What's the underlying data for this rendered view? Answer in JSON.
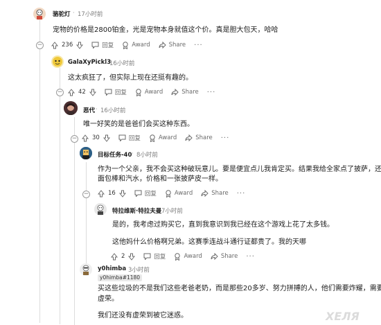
{
  "comments": [
    {
      "username": "骆驼灯",
      "time": "17小时前",
      "text": "宠物的价格是2800铂金，光是宠物本身就值这个价。真是胆大包天，哈哈",
      "votes": "236",
      "reply": "回复",
      "award": "Award",
      "share": "Share",
      "more": "···"
    },
    {
      "username": "GalaXyPickl3",
      "time": "16小时前",
      "text": "这太疯狂了，但实际上现在还挺有趣的。",
      "votes": "42",
      "reply": "回复",
      "award": "Award",
      "share": "Share",
      "more": "···"
    },
    {
      "username": "恶代",
      "time": "16小时前",
      "text": "唯一好笑的是爸爸们会买这种东西。",
      "votes": "30",
      "reply": "回复",
      "award": "Award",
      "share": "Share",
      "more": "···"
    },
    {
      "username": "目标任务-40",
      "time": "8小时前",
      "text_line1": "作为一个父亲，我不会买这种破玩意儿。要是便宜点儿我肯定买。结果我给全家点了披萨，还有",
      "text_line2": "面包棒和汽水，价格和一张披萨皮一样。",
      "votes": "16",
      "reply": "回复",
      "award": "Award",
      "share": "Share",
      "more": "···"
    },
    {
      "username": "特拉维斯·特拉夫曼",
      "time": "7小时前",
      "text_line1": "是的，我考虑过购买它，直到我意识到我已经在这个游戏上花了太多钱。",
      "text_line2": "这他妈什么价格啊兄弟。这赛季连战斗通行证都贵了。我的天哪",
      "votes": "2",
      "reply": "回复",
      "award": "Award",
      "share": "Share",
      "more": "···"
    },
    {
      "username": "y0himba",
      "time": "3小时前",
      "flair": "y0himba#1180",
      "text_line1": "买这些垃圾的不是我们这些老爸老奶，而是那些20多岁、努力拼搏的人，他们需要炸耀，需要",
      "text_line2": "虚荣。",
      "text_line3": "我们还没有虚荣到被它迷惑。"
    }
  ],
  "watermark": "ХЕЛЯ",
  "colors": {
    "text": "#1c1c1c",
    "meta": "#7c7c7c",
    "thread": "#dcdcdc",
    "background": "#ffffff"
  }
}
